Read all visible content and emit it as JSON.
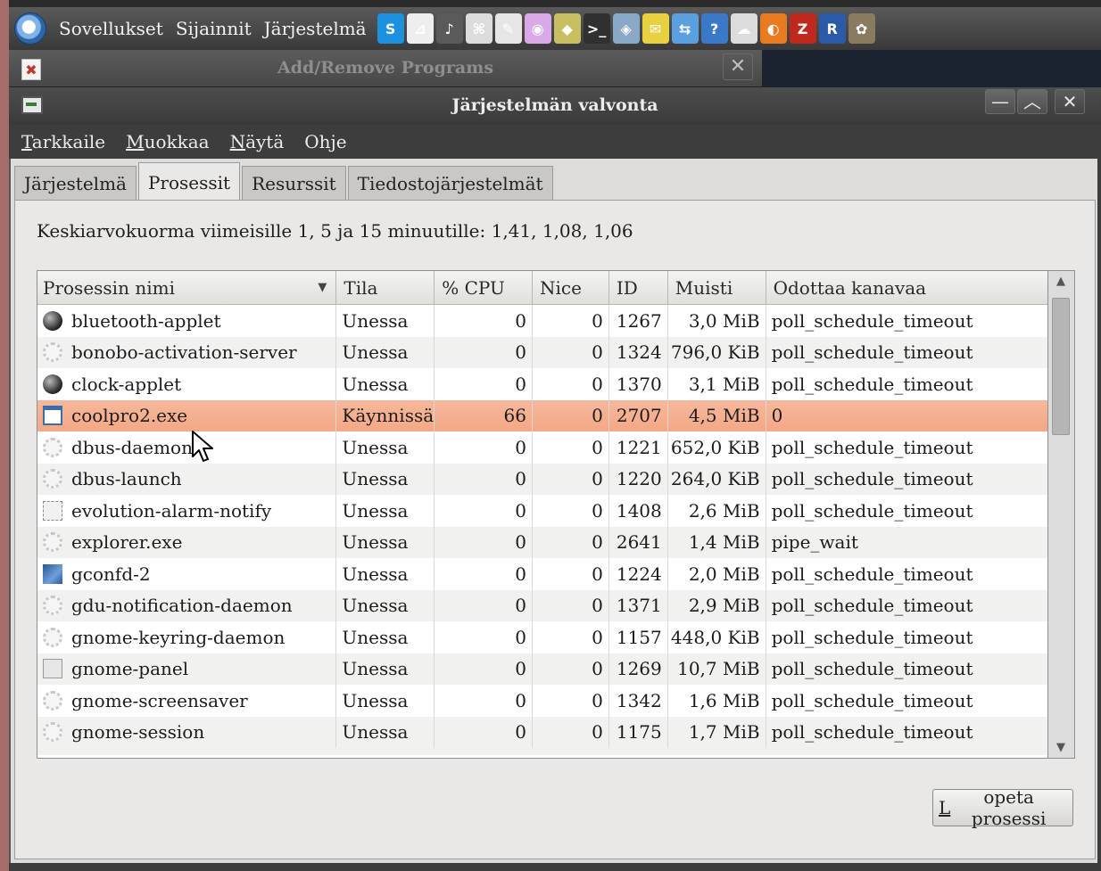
{
  "top_panel": {
    "menus": [
      "Sovellukset",
      "Sijainnit",
      "Järjestelmä"
    ],
    "tray_icons": [
      {
        "name": "skype-icon",
        "glyph": "S",
        "bg": "#1e90e0"
      },
      {
        "name": "chart-app-icon",
        "glyph": "⊿",
        "bg": "#eeeeee"
      },
      {
        "name": "audio-icon",
        "glyph": "♪",
        "bg": "#5a5a5a"
      },
      {
        "name": "image-viewer-icon",
        "glyph": "⌘",
        "bg": "#dcdcdc"
      },
      {
        "name": "inkscape-icon",
        "glyph": "✎",
        "bg": "#e6e6e6"
      },
      {
        "name": "cd-burner-icon",
        "glyph": "◉",
        "bg": "#d8a8e8"
      },
      {
        "name": "package-icon",
        "glyph": "◆",
        "bg": "#c8c060"
      },
      {
        "name": "terminal-icon",
        "glyph": ">_",
        "bg": "#303030"
      },
      {
        "name": "remote-desktop-icon",
        "glyph": "◈",
        "bg": "#8aa8c8"
      },
      {
        "name": "easytag-icon",
        "glyph": "✉",
        "bg": "#e8d040"
      },
      {
        "name": "network-icon",
        "glyph": "⇆",
        "bg": "#5aa0e0"
      },
      {
        "name": "help-icon",
        "glyph": "?",
        "bg": "#3a78c8"
      },
      {
        "name": "tomboy-icon",
        "glyph": "☁",
        "bg": "#dcdcdc"
      },
      {
        "name": "firefox-icon",
        "glyph": "◐",
        "bg": "#e87a20"
      },
      {
        "name": "filezilla-icon",
        "glyph": "Z",
        "bg": "#c0281e"
      },
      {
        "name": "r-icon",
        "glyph": "R",
        "bg": "#2a5aa8"
      },
      {
        "name": "gimp-icon",
        "glyph": "✿",
        "bg": "#8a7a60"
      }
    ]
  },
  "background_window": {
    "title": "Add/Remove Programs",
    "close_glyph": "✕"
  },
  "window": {
    "title": "Järjestelmän valvonta",
    "minimize_glyph": "—",
    "maximize_glyph": "︿",
    "close_glyph": "✕"
  },
  "menubar": [
    {
      "first": "T",
      "rest": "arkkaile"
    },
    {
      "first": "M",
      "rest": "uokkaa"
    },
    {
      "first": "N",
      "rest": "äytä"
    },
    {
      "first": "Oh",
      "rest": "je",
      "underline_index": 1
    }
  ],
  "tabs": [
    "Järjestelmä",
    "Prosessit",
    "Resurssit",
    "Tiedostojärjestelmät"
  ],
  "active_tab": "Prosessit",
  "load_average_text": "Keskiarvokuorma viimeisille 1, 5 ja 15 minuutille: 1,41, 1,08, 1,06",
  "table": {
    "columns": [
      "Prosessin nimi",
      "Tila",
      "% CPU",
      "Nice",
      "ID",
      "Muisti",
      "Odottaa kanavaa"
    ],
    "sort_arrow": "▼",
    "rows": [
      {
        "icon": "ball",
        "name": "bluetooth-applet",
        "state": "Unessa",
        "cpu": "0",
        "nice": "0",
        "id": "1267",
        "mem": "3,0 MiB",
        "wchan": "poll_schedule_timeout"
      },
      {
        "icon": "gear",
        "name": "bonobo-activation-server",
        "state": "Unessa",
        "cpu": "0",
        "nice": "0",
        "id": "1324",
        "mem": "796,0 KiB",
        "wchan": "poll_schedule_timeout"
      },
      {
        "icon": "ball",
        "name": "clock-applet",
        "state": "Unessa",
        "cpu": "0",
        "nice": "0",
        "id": "1370",
        "mem": "3,1 MiB",
        "wchan": "poll_schedule_timeout"
      },
      {
        "icon": "win",
        "name": "coolpro2.exe",
        "state": "Käynnissä",
        "cpu": "66",
        "nice": "0",
        "id": "2707",
        "mem": "4,5 MiB",
        "wchan": "0",
        "selected": true
      },
      {
        "icon": "gear",
        "name": "dbus-daemon",
        "state": "Unessa",
        "cpu": "0",
        "nice": "0",
        "id": "1221",
        "mem": "652,0 KiB",
        "wchan": "poll_schedule_timeout"
      },
      {
        "icon": "gear",
        "name": "dbus-launch",
        "state": "Unessa",
        "cpu": "0",
        "nice": "0",
        "id": "1220",
        "mem": "264,0 KiB",
        "wchan": "poll_schedule_timeout"
      },
      {
        "icon": "evo",
        "name": "evolution-alarm-notify",
        "state": "Unessa",
        "cpu": "0",
        "nice": "0",
        "id": "1408",
        "mem": "2,6 MiB",
        "wchan": "poll_schedule_timeout"
      },
      {
        "icon": "gear",
        "name": "explorer.exe",
        "state": "Unessa",
        "cpu": "0",
        "nice": "0",
        "id": "2641",
        "mem": "1,4 MiB",
        "wchan": "pipe_wait"
      },
      {
        "icon": "gconf",
        "name": "gconfd-2",
        "state": "Unessa",
        "cpu": "0",
        "nice": "0",
        "id": "1224",
        "mem": "2,0 MiB",
        "wchan": "poll_schedule_timeout"
      },
      {
        "icon": "gear",
        "name": "gdu-notification-daemon",
        "state": "Unessa",
        "cpu": "0",
        "nice": "0",
        "id": "1371",
        "mem": "2,9 MiB",
        "wchan": "poll_schedule_timeout"
      },
      {
        "icon": "gear",
        "name": "gnome-keyring-daemon",
        "state": "Unessa",
        "cpu": "0",
        "nice": "0",
        "id": "1157",
        "mem": "448,0 KiB",
        "wchan": "poll_schedule_timeout"
      },
      {
        "icon": "panel",
        "name": "gnome-panel",
        "state": "Unessa",
        "cpu": "0",
        "nice": "0",
        "id": "1269",
        "mem": "10,7 MiB",
        "wchan": "poll_schedule_timeout"
      },
      {
        "icon": "gear",
        "name": "gnome-screensaver",
        "state": "Unessa",
        "cpu": "0",
        "nice": "0",
        "id": "1342",
        "mem": "1,6 MiB",
        "wchan": "poll_schedule_timeout"
      },
      {
        "icon": "gear",
        "name": "gnome-session",
        "state": "Unessa",
        "cpu": "0",
        "nice": "0",
        "id": "1175",
        "mem": "1,7 MiB",
        "wchan": "poll_schedule_timeout"
      }
    ]
  },
  "end_process_button": {
    "first": "L",
    "rest": "opeta prosessi"
  },
  "colors": {
    "selected_row": "#f3a886",
    "panel_bg": "#393939",
    "content_bg": "#e9e8e6"
  }
}
